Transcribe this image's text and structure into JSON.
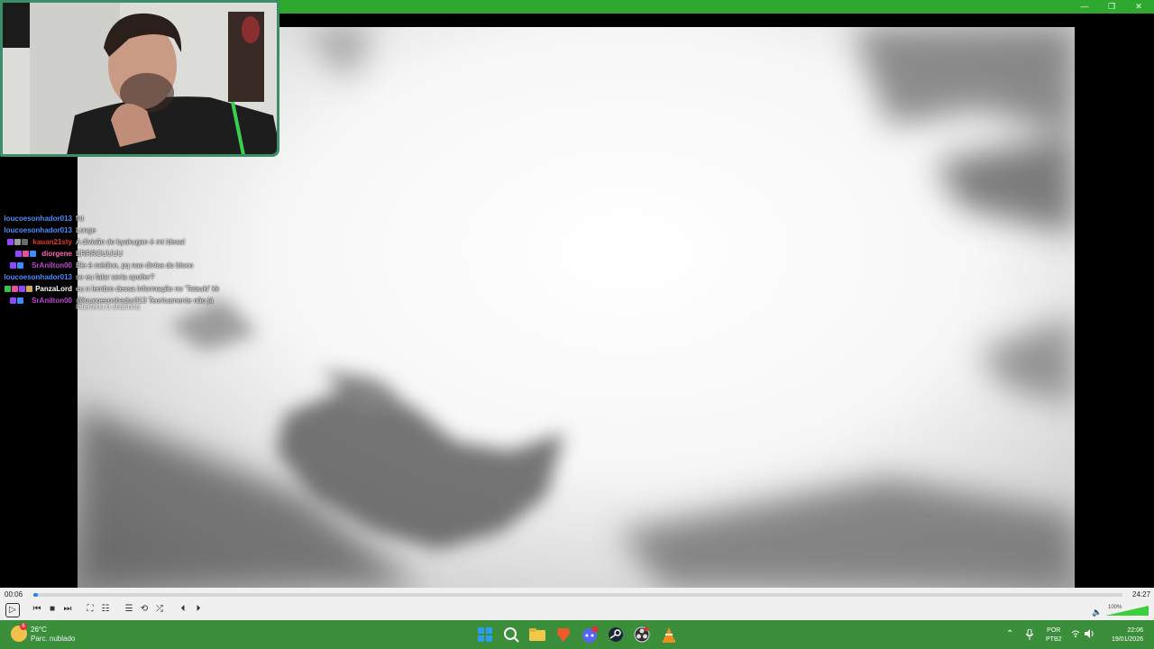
{
  "window": {
    "minimize_glyph": "—",
    "maximize_glyph": "❐",
    "close_glyph": "✕",
    "accent": "#2ea82e"
  },
  "chat": {
    "messages": [
      {
        "user": "loucoesonhador013",
        "color": "#4a8cff",
        "text": "fnt",
        "badges": []
      },
      {
        "user": "loucoesonhador013",
        "color": "#4a8cff",
        "text": "Longe",
        "badges": []
      },
      {
        "user": "kauan21sty",
        "color": "#e8332a",
        "text": "A divisão do byakugan é mt idesa!",
        "badges": [
          "#9147ff",
          "#9a9a9a",
          "#6b6b6b"
        ]
      },
      {
        "user": "diorgene",
        "color": "#ff69b4",
        "text": "ERRROUUUU",
        "badges": [
          "#9147ff",
          "#e84fa0",
          "#3d8bff"
        ]
      },
      {
        "user": "SrAnilton00",
        "color": "#c045d4",
        "text": "Ele é médico, pq nao divisa do bloco",
        "badges": [
          "#9147ff",
          "#3d8bff"
        ]
      },
      {
        "user": "loucoesonhador013",
        "color": "#4a8cff",
        "text": "se eu falar seria spoiler?",
        "badges": []
      },
      {
        "user": "PanzaLord",
        "color": "#ffffff",
        "text": "eu n lembro dessa informação no 'Tatsuki' kk",
        "badges": [
          "#37c24a",
          "#e84fa0",
          "#9147ff",
          "#d4a95a"
        ]
      },
      {
        "user": "SrAnilton00",
        "color": "#c045d4",
        "text": "@loucoesonhador013 Teoricamente não já",
        "badges": [
          "#9147ff",
          "#3d8bff"
        ]
      }
    ],
    "continuation": "Interferiu o sharinha"
  },
  "player": {
    "current_time": "00:06",
    "total_time": "24:27",
    "progress_fraction": 0.004,
    "volume_label": "100%",
    "volume_fraction": 1.0,
    "buttons": {
      "play": "▷",
      "prev": "⏮",
      "stop": "■",
      "next": "⏭",
      "fullscreen": "⛶",
      "extended": "☷",
      "playlist": "☰",
      "loop": "⟲",
      "shuffle": "⤮",
      "frame_back": "⏴",
      "frame_fwd": "⏵"
    }
  },
  "taskbar": {
    "weather": {
      "temp": "26°C",
      "desc": "Parc. nublado",
      "badge": "6"
    },
    "apps": [
      {
        "name": "start",
        "color": "#2b9cf3"
      },
      {
        "name": "search",
        "color": "transparent"
      },
      {
        "name": "file-explorer",
        "color": "#f2c94c"
      },
      {
        "name": "brave",
        "color": "#f05a28"
      },
      {
        "name": "discord",
        "color": "#5865f2"
      },
      {
        "name": "steam",
        "color": "#1b2838"
      },
      {
        "name": "obs",
        "color": "#302e31"
      },
      {
        "name": "vlc",
        "color": "#f28c1b"
      }
    ],
    "tray": {
      "chevron": "⌃",
      "mic": "🎙",
      "wifi": "⌔",
      "speaker": "🔊",
      "lang_top": "POR",
      "lang_bottom": "PTB2",
      "time": "22:06",
      "date": "19/01/2026"
    }
  }
}
